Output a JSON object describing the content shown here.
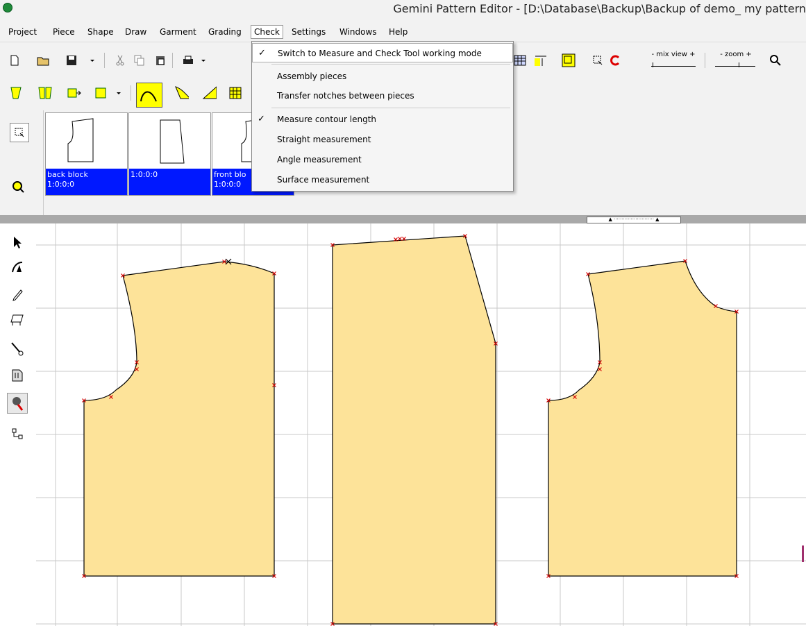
{
  "window": {
    "title": "Gemini Pattern Editor - [D:\\Database\\Backup\\Backup of demo_ my pattern"
  },
  "menu": [
    "Project",
    "Piece",
    "Shape",
    "Draw",
    "Garment",
    "Grading",
    "Check",
    "Settings",
    "Windows",
    "Help"
  ],
  "toolbar": {
    "mix_view_label": "- mix view +",
    "zoom_label": "- zoom +"
  },
  "dropdown": {
    "items": [
      {
        "label": "Switch to Measure and Check Tool working mode",
        "checked": true
      },
      {
        "label": "Assembly pieces",
        "checked": false
      },
      {
        "label": "Transfer notches between pieces",
        "checked": false
      },
      {
        "label": "Measure contour length",
        "checked": true
      },
      {
        "label": "Straight measurement",
        "checked": false
      },
      {
        "label": "Angle measurement",
        "checked": false
      },
      {
        "label": "Surface measurement",
        "checked": false
      }
    ],
    "check_glyph": "✓"
  },
  "pieces": [
    {
      "name": "back block",
      "size": "1:0:0:0"
    },
    {
      "name": "",
      "size": "1:0:0:0"
    },
    {
      "name": "front blo",
      "size": "1:0:0:0"
    }
  ],
  "colors": {
    "piece_fill": "#fde399",
    "selection_blue": "#0018ff",
    "grid": "#c8c8c8",
    "point": "#d40000"
  },
  "icons": [
    "new-icon",
    "open-icon",
    "save-icon",
    "cut-icon",
    "copy-icon",
    "paste-icon",
    "print-icon",
    "arrow-select-icon",
    "bezier-icon",
    "pencil-icon",
    "table-icon",
    "measure-pin-icon",
    "notch-icon",
    "tape-measure-icon",
    "grid-move-icon",
    "zoom-icon",
    "select-box-icon"
  ]
}
